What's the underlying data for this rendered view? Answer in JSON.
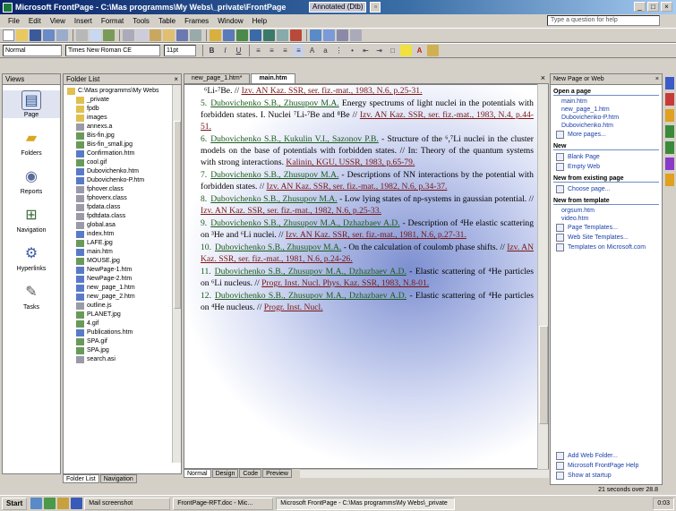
{
  "window": {
    "title": "Microsoft FrontPage - C:\\Mas programms\\My Webs\\_private\\FrontPage",
    "inner_tab": "Annotated (Dtb)",
    "win_buttons": [
      "_",
      "□",
      "×"
    ]
  },
  "menu": {
    "items": [
      "File",
      "Edit",
      "View",
      "Insert",
      "Format",
      "Tools",
      "Table",
      "Frames",
      "Window",
      "Help"
    ],
    "ask_placeholder": "Type a question for help"
  },
  "format_toolbar": {
    "style": "Normal",
    "font": "Times New Roman CE",
    "size": "11pt"
  },
  "views": {
    "header": "Views",
    "items": [
      {
        "name": "page",
        "label": "Page"
      },
      {
        "name": "folders",
        "label": "Folders"
      },
      {
        "name": "reports",
        "label": "Reports"
      },
      {
        "name": "navigation",
        "label": "Navigation"
      },
      {
        "name": "hyperlinks",
        "label": "Hyperlinks"
      },
      {
        "name": "tasks",
        "label": "Tasks"
      }
    ]
  },
  "folder_list": {
    "header": "Folder List",
    "items": [
      {
        "label": "C:\\Mas programms\\My Webs",
        "type": "folder",
        "indent": 0
      },
      {
        "label": "_private",
        "type": "folder",
        "indent": 1
      },
      {
        "label": "fpdb",
        "type": "folder",
        "indent": 1
      },
      {
        "label": "images",
        "type": "folder",
        "indent": 1
      },
      {
        "label": "annexs.a",
        "type": "file",
        "indent": 1
      },
      {
        "label": "Bis-fin.jpg",
        "type": "image",
        "indent": 1
      },
      {
        "label": "Bis-fin_small.jpg",
        "type": "image",
        "indent": 1
      },
      {
        "label": "Confirmation.htm",
        "type": "page",
        "indent": 1
      },
      {
        "label": "cool.gif",
        "type": "image",
        "indent": 1
      },
      {
        "label": "Dubovichenko.htm",
        "type": "page",
        "indent": 1
      },
      {
        "label": "Dubovichenko-P.htm",
        "type": "page",
        "indent": 1
      },
      {
        "label": "fphover.class",
        "type": "file",
        "indent": 1
      },
      {
        "label": "fphoverx.class",
        "type": "file",
        "indent": 1
      },
      {
        "label": "fpdata.class",
        "type": "file",
        "indent": 1
      },
      {
        "label": "fpdtdata.class",
        "type": "file",
        "indent": 1
      },
      {
        "label": "global.asa",
        "type": "file",
        "indent": 1
      },
      {
        "label": "index.htm",
        "type": "page",
        "indent": 1
      },
      {
        "label": "LAFE.jpg",
        "type": "image",
        "indent": 1
      },
      {
        "label": "main.htm",
        "type": "page",
        "indent": 1
      },
      {
        "label": "MOUSE.jpg",
        "type": "image",
        "indent": 1
      },
      {
        "label": "NewPage-1.htm",
        "type": "page",
        "indent": 1
      },
      {
        "label": "NewPage-2.htm",
        "type": "page",
        "indent": 1
      },
      {
        "label": "new_page_1.htm",
        "type": "page",
        "indent": 1
      },
      {
        "label": "new_page_2.htm",
        "type": "page",
        "indent": 1
      },
      {
        "label": "outline.js",
        "type": "file",
        "indent": 1
      },
      {
        "label": "PLANET.jpg",
        "type": "image",
        "indent": 1
      },
      {
        "label": "4.gif",
        "type": "image",
        "indent": 1
      },
      {
        "label": "Publications.htm",
        "type": "page",
        "indent": 1
      },
      {
        "label": "SPA.gif",
        "type": "image",
        "indent": 1
      },
      {
        "label": "SPA.jpg",
        "type": "image",
        "indent": 1
      },
      {
        "label": "search.asi",
        "type": "file",
        "indent": 1
      }
    ],
    "tabs": [
      "Folder List",
      "Navigation"
    ]
  },
  "document": {
    "tabs": [
      "new_page_1.htm*",
      "main.htm"
    ],
    "active_tab": 1,
    "view_tabs": [
      "Normal",
      "Design",
      "Code",
      "Preview"
    ],
    "refs": [
      {
        "num": "",
        "authors": "",
        "rest": "⁶Li-⁷Be. // ",
        "cite": "Izv. AN Kaz. SSR, ser. fiz.-mat., 1983, N.6, p.25-31.",
        "tail": ""
      },
      {
        "num": "5.",
        "authors": "Dubovichenko S.B., Zhusupov M.A.",
        "rest": " Energy spectrums of light nuclei in the potentials with forbidden states. I. Nuclei ⁷Li-⁷Be and ⁸Be // ",
        "cite": "Izv. AN Kaz. SSR, ser. fiz.-mat., 1983, N.4, p.44-51.",
        "tail": ""
      },
      {
        "num": "6.",
        "authors": "Dubovichenko S.B., Kukulin V.I., Sazonov P.B.",
        "rest": " - Structure of the ⁶,⁷Li nuclei in the cluster models on the base of potentials with forbidden states. // In: Theory of the quantum systems with strong interactions. ",
        "cite": "Kalinin, KGU, USSR, 1983, p.65-79.",
        "tail": ""
      },
      {
        "num": "7.",
        "authors": "Dubovichenko S.B., Zhusupov M.A.",
        "rest": " - Descriptions of NN interactions by the potential with forbidden states. // ",
        "cite": "Izv. AN Kaz. SSR, ser. fiz.-mat., 1982, N.6, p.34-37.",
        "tail": ""
      },
      {
        "num": "8.",
        "authors": "Dubovichenko S.B., Zhusupov M.A.",
        "rest": " - Low lying states of np-systems in gaussian potential. // ",
        "cite": "Izv. AN Kaz. SSR, ser. fiz.-mat., 1982, N.6, p.25-33.",
        "tail": ""
      },
      {
        "num": "9.",
        "authors": "Dubovichenko S.B., Zhusupov M.A., Dzhazbaev A.D.",
        "rest": " - Description of ⁴He elastic scattering on ³He and ⁶Li nuclei. // ",
        "cite": "Izv. AN Kaz. SSR, ser. fiz.-mat., 1981, N.6, p.27-31.",
        "tail": ""
      },
      {
        "num": "10.",
        "authors": "Dubovichenko S.B., Zhusupov M.A.",
        "rest": " - On the calculation of coulomb phase shifts. // ",
        "cite": "Izv. AN Kaz. SSR, ser. fiz.-mat., 1981, N.6, p.24-26.",
        "tail": ""
      },
      {
        "num": "11.",
        "authors": "Dubovichenko S.B., Zhusupov M.A., Dzhazbaev A.D.",
        "rest": " - Elastic scattering of ⁴He particles on ⁶Li nucleus. // ",
        "cite": "Progr. Inst. Nucl. Phys. Kaz. SSR, 1983, N.8-01.",
        "tail": ""
      },
      {
        "num": "12.",
        "authors": "Dubovichenko S.B., Zhusupov M.A., Dzhazbaev A.D.",
        "rest": " - Elastic scattering of ⁴He particles on ⁴He nucleus. // ",
        "cite": "Progr. Inst. Nucl.",
        "tail": ""
      }
    ]
  },
  "task_pane": {
    "header": "New Page or Web",
    "sections": [
      {
        "title": "Open a page",
        "links": [
          "main.htm",
          "new_page_1.htm",
          "Dubovichenko-P.htm",
          "Dubovichenko.htm"
        ],
        "icon_links": [
          "More pages..."
        ]
      },
      {
        "title": "New",
        "links": [],
        "icon_links": [
          "Blank Page",
          "Empty Web"
        ]
      },
      {
        "title": "New from existing page",
        "links": [],
        "icon_links": [
          "Choose page..."
        ]
      },
      {
        "title": "New from template",
        "links": [
          "orgsum.htm",
          "video.htm"
        ],
        "icon_links": [
          "Page Templates...",
          "Web Site Templates...",
          "Templates on Microsoft.com"
        ]
      }
    ],
    "bottom_links": [
      "Add Web Folder...",
      "Microsoft FrontPage Help",
      "Show at startup"
    ]
  },
  "status": {
    "text": "21 seconds over 28.8"
  },
  "taskbar": {
    "start": "Start",
    "tasks": [
      "Mail screenshot",
      "FrontPage-RFT.doc - Mic...",
      "Microsoft FrontPage - C:\\Mas programms\\My Webs\\_private"
    ],
    "active_task": 2,
    "clock": "0:03"
  },
  "colors": {
    "accent": "#0a246a",
    "link": "#1a3fa8",
    "author": "#1a5c1a",
    "citation": "#7a1515"
  }
}
